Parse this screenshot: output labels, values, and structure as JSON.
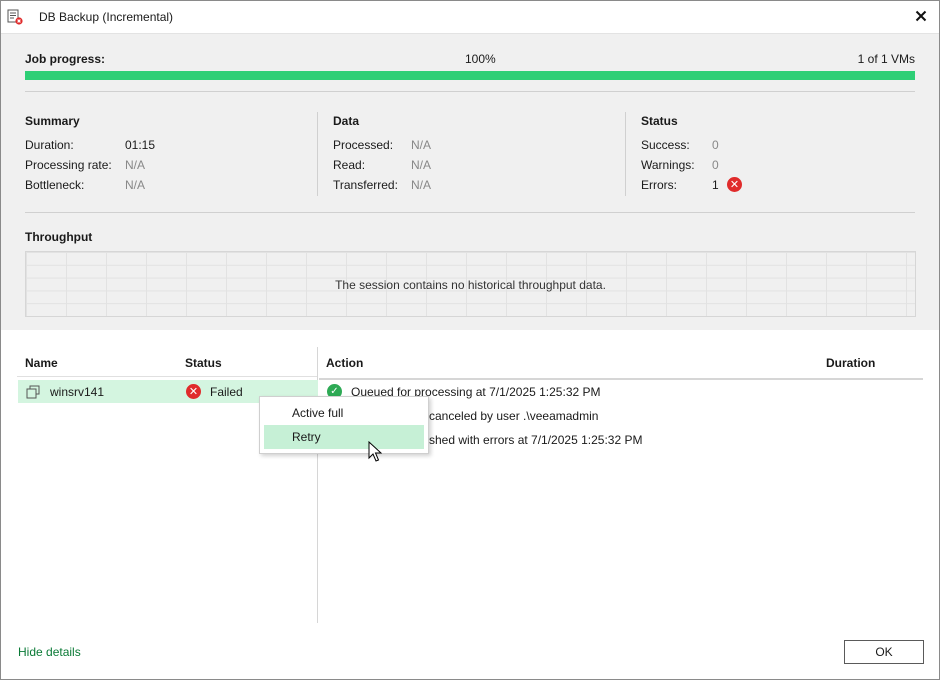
{
  "window": {
    "title": "DB Backup (Incremental)",
    "icon": "backup-job-error-icon",
    "close_icon": "close-icon"
  },
  "job_progress": {
    "label": "Job progress:",
    "percent_text": "100%",
    "percent_value": 100,
    "count_text": "1 of 1 VMs",
    "bar_color": "#2ecf76"
  },
  "summary": {
    "heading": "Summary",
    "rows": [
      {
        "key": "Duration:",
        "value": "01:15"
      },
      {
        "key": "Processing rate:",
        "value": "N/A"
      },
      {
        "key": "Bottleneck:",
        "value": "N/A"
      }
    ]
  },
  "data": {
    "heading": "Data",
    "rows": [
      {
        "key": "Processed:",
        "value": "N/A"
      },
      {
        "key": "Read:",
        "value": "N/A"
      },
      {
        "key": "Transferred:",
        "value": "N/A"
      }
    ]
  },
  "status": {
    "heading": "Status",
    "rows": [
      {
        "key": "Success:",
        "value": "0"
      },
      {
        "key": "Warnings:",
        "value": "0"
      },
      {
        "key": "Errors:",
        "value": "1"
      }
    ],
    "error_color": "#e02b2b"
  },
  "throughput": {
    "heading": "Throughput",
    "message": "The session contains no historical throughput data."
  },
  "vm_table": {
    "columns": {
      "name": "Name",
      "status": "Status"
    },
    "rows": [
      {
        "name": "winsrv141",
        "status": "Failed",
        "icon": "vm-icon",
        "status_icon": "error-icon"
      }
    ]
  },
  "action_table": {
    "columns": {
      "action": "Action",
      "duration": "Duration"
    },
    "rows": [
      {
        "text": "Queued for processing at 7/1/2025 1:25:32 PM",
        "icon": "success-check-icon"
      },
      {
        "text": "canceled by user .\\veeamadmin",
        "icon": ""
      },
      {
        "text": "shed with errors at 7/1/2025 1:25:32 PM",
        "icon": ""
      }
    ]
  },
  "context_menu": {
    "items": [
      {
        "label": "Active full"
      },
      {
        "label": "Retry"
      }
    ],
    "hover_color": "#c6f0d6"
  },
  "footer": {
    "hide_details": "Hide details",
    "ok": "OK",
    "link_color": "#0a7a36"
  }
}
